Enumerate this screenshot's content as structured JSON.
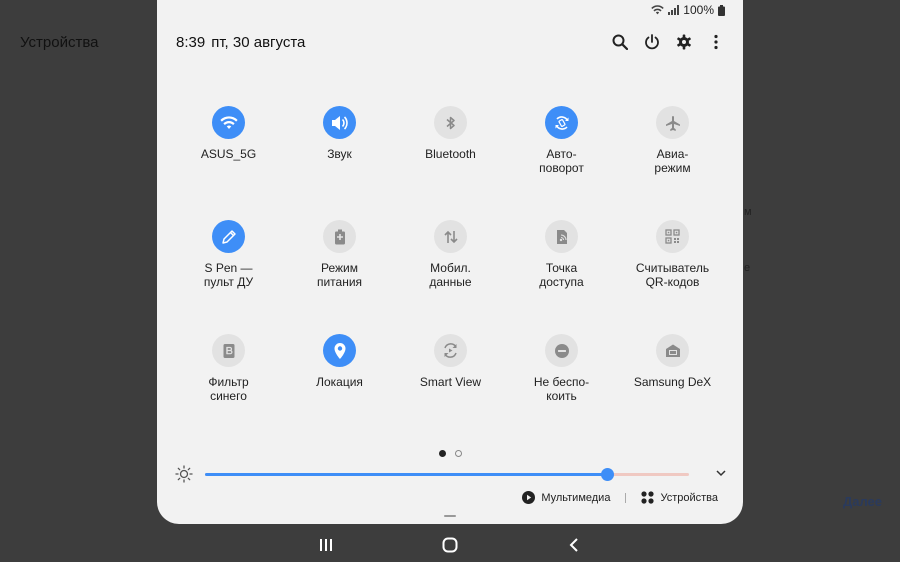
{
  "background": {
    "title": "Устройства",
    "next_label": "Далее",
    "frag1": "м",
    "frag2": "е"
  },
  "status_bar": {
    "battery": "100%",
    "icons": [
      "wifi-icon",
      "signal-icon",
      "battery-icon"
    ]
  },
  "header": {
    "time": "8:39",
    "date": "пт, 30 августа",
    "icons": [
      "search-icon",
      "power-icon",
      "settings-icon",
      "more-icon"
    ]
  },
  "tiles": [
    {
      "label": "ASUS_5G",
      "icon": "wifi-icon",
      "active": true
    },
    {
      "label": "Звук",
      "icon": "sound-icon",
      "active": true
    },
    {
      "label": "Bluetooth",
      "icon": "bluetooth-icon",
      "active": false
    },
    {
      "label": "Авто-\nповорот",
      "icon": "autorotate-icon",
      "active": true
    },
    {
      "label": "Авиа-\nрежим",
      "icon": "airplane-icon",
      "active": false
    },
    {
      "label": "S Pen —\nпульт ДУ",
      "icon": "spen-icon",
      "active": true
    },
    {
      "label": "Режим\nпитания",
      "icon": "power-mode-icon",
      "active": false
    },
    {
      "label": "Мобил.\nданные",
      "icon": "mobile-data-icon",
      "active": false
    },
    {
      "label": "Точка\nдоступа",
      "icon": "hotspot-icon",
      "active": false
    },
    {
      "label": "Считыватель\nQR-кодов",
      "icon": "qr-icon",
      "active": false
    },
    {
      "label": "Фильтр\nсинего",
      "icon": "blue-filter-icon",
      "active": false
    },
    {
      "label": "Локация",
      "icon": "location-icon",
      "active": true
    },
    {
      "label": "Smart View",
      "icon": "smart-view-icon",
      "active": false
    },
    {
      "label": "Не беспо-\nкоить",
      "icon": "dnd-icon",
      "active": false
    },
    {
      "label": "Samsung DeX",
      "icon": "dex-icon",
      "active": false
    }
  ],
  "pagination": {
    "pages": 2,
    "current": 1
  },
  "brightness": {
    "level": 0.83
  },
  "bottom": {
    "media_label": "Мультимедиа",
    "devices_label": "Устройства"
  },
  "nav": {
    "icons": [
      "recent-apps-icon",
      "home-icon",
      "back-icon"
    ]
  },
  "colors": {
    "accent": "#3e8ef7",
    "inactive_tile": "#e2e2e2",
    "panel": "#f2f2f2"
  }
}
